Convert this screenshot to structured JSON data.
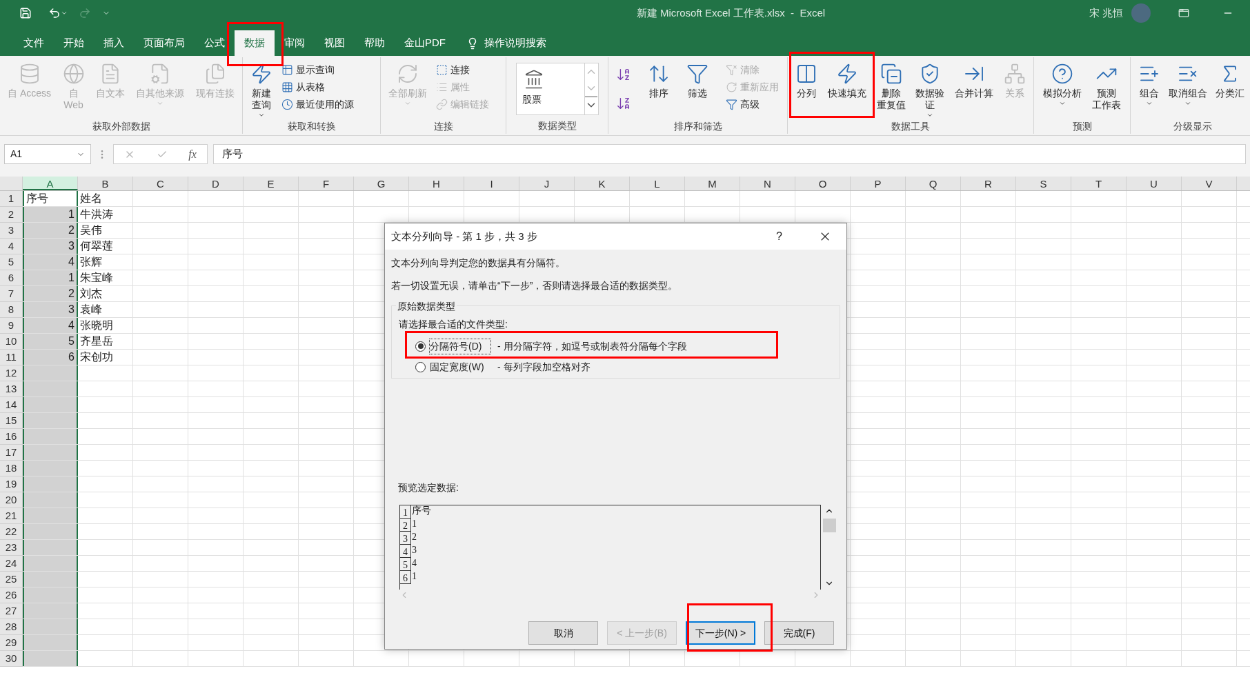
{
  "window": {
    "title": "新建 Microsoft Excel 工作表.xlsx  -  Excel",
    "user": "宋 兆恒"
  },
  "quick_access": {
    "redo_disabled": true
  },
  "menu_tabs": [
    {
      "label": "文件",
      "selected": false
    },
    {
      "label": "开始",
      "selected": false
    },
    {
      "label": "插入",
      "selected": false
    },
    {
      "label": "页面布局",
      "selected": false
    },
    {
      "label": "公式",
      "selected": false
    },
    {
      "label": "数据",
      "selected": true
    },
    {
      "label": "审阅",
      "selected": false
    },
    {
      "label": "视图",
      "selected": false
    },
    {
      "label": "帮助",
      "selected": false
    },
    {
      "label": "金山PDF",
      "selected": false
    }
  ],
  "tell_me": "操作说明搜索",
  "ribbon": {
    "groups": [
      {
        "label": "获取外部数据",
        "items": [
          {
            "kind": "large",
            "lines": [
              "自 Access"
            ],
            "disabled": true
          },
          {
            "kind": "large",
            "lines": [
              "自",
              "Web"
            ],
            "disabled": true
          },
          {
            "kind": "large",
            "lines": [
              "自文本"
            ],
            "disabled": true
          },
          {
            "kind": "large",
            "lines": [
              "自其他来源"
            ],
            "disabled": true,
            "dropdown": true
          },
          {
            "kind": "large",
            "lines": [
              "现有连接"
            ],
            "disabled": true
          }
        ]
      },
      {
        "label": "获取和转换",
        "items": [
          {
            "kind": "large",
            "lines": [
              "新建",
              "查询"
            ],
            "disabled": false,
            "dropdown": true
          },
          {
            "kind": "small",
            "lines": [
              "显示查询"
            ],
            "disabled": false
          },
          {
            "kind": "small",
            "lines": [
              "从表格"
            ],
            "disabled": false
          },
          {
            "kind": "small",
            "lines": [
              "最近使用的源"
            ],
            "disabled": false
          }
        ]
      },
      {
        "label": "连接",
        "items": [
          {
            "kind": "large",
            "lines": [
              "全部刷新"
            ],
            "disabled": true,
            "dropdown": true
          },
          {
            "kind": "small",
            "lines": [
              "连接"
            ],
            "disabled": false
          },
          {
            "kind": "small",
            "lines": [
              "属性"
            ],
            "disabled": true
          },
          {
            "kind": "small",
            "lines": [
              "编辑链接"
            ],
            "disabled": true
          }
        ]
      },
      {
        "label": "数据类型",
        "items": [
          {
            "kind": "gallery",
            "lines": [
              "股票"
            ],
            "disabled": false
          }
        ]
      },
      {
        "label": "排序和筛选",
        "items": [
          {
            "kind": "icon",
            "disabled": false
          },
          {
            "kind": "icon",
            "disabled": false
          },
          {
            "kind": "large",
            "lines": [
              "排序"
            ],
            "disabled": false
          },
          {
            "kind": "large",
            "lines": [
              "筛选"
            ],
            "disabled": false
          },
          {
            "kind": "small",
            "lines": [
              "清除"
            ],
            "disabled": true
          },
          {
            "kind": "small",
            "lines": [
              "重新应用"
            ],
            "disabled": true
          },
          {
            "kind": "small",
            "lines": [
              "高级"
            ],
            "disabled": false
          }
        ]
      },
      {
        "label": "数据工具",
        "items": [
          {
            "kind": "large",
            "lines": [
              "分列"
            ],
            "disabled": false
          },
          {
            "kind": "large",
            "lines": [
              "快速填充"
            ],
            "disabled": false
          },
          {
            "kind": "large",
            "lines": [
              "删除",
              "重复值"
            ],
            "disabled": false
          },
          {
            "kind": "large",
            "lines": [
              "数据验",
              "证"
            ],
            "disabled": false,
            "dropdown": true
          },
          {
            "kind": "large",
            "lines": [
              "合并计算"
            ],
            "disabled": false
          },
          {
            "kind": "large",
            "lines": [
              "关系"
            ],
            "disabled": true
          }
        ]
      },
      {
        "label": "预测",
        "items": [
          {
            "kind": "large",
            "lines": [
              "模拟分析"
            ],
            "disabled": false,
            "dropdown": true
          },
          {
            "kind": "large",
            "lines": [
              "预测",
              "工作表"
            ],
            "disabled": false
          }
        ]
      },
      {
        "label": "分级显示",
        "items": [
          {
            "kind": "large",
            "lines": [
              "组合"
            ],
            "disabled": false,
            "dropdown": true
          },
          {
            "kind": "large",
            "lines": [
              "取消组合"
            ],
            "disabled": false,
            "dropdown": true
          },
          {
            "kind": "large",
            "lines": [
              "分类汇"
            ],
            "disabled": false
          }
        ]
      }
    ]
  },
  "formula_bar": {
    "name_box": "A1",
    "function_label": "fx",
    "formula": "序号"
  },
  "sheet": {
    "columns": [
      {
        "label": "A",
        "selected": true
      },
      {
        "label": "B",
        "selected": false
      },
      {
        "label": "C",
        "selected": false
      },
      {
        "label": "D",
        "selected": false
      },
      {
        "label": "E",
        "selected": false
      },
      {
        "label": "F",
        "selected": false
      },
      {
        "label": "G",
        "selected": false
      },
      {
        "label": "H",
        "selected": false
      },
      {
        "label": "I",
        "selected": false
      },
      {
        "label": "J",
        "selected": false
      },
      {
        "label": "K",
        "selected": false
      },
      {
        "label": "L",
        "selected": false
      },
      {
        "label": "M",
        "selected": false
      },
      {
        "label": "N",
        "selected": false
      },
      {
        "label": "O",
        "selected": false
      },
      {
        "label": "P",
        "selected": false
      },
      {
        "label": "Q",
        "selected": false
      },
      {
        "label": "R",
        "selected": false
      },
      {
        "label": "S",
        "selected": false
      },
      {
        "label": "T",
        "selected": false
      },
      {
        "label": "U",
        "selected": false
      },
      {
        "label": "V",
        "selected": false
      }
    ],
    "rows": [
      {
        "label": "1",
        "cells": [
          {
            "text": "序号",
            "kind": "text",
            "active": true
          },
          {
            "text": "姓名",
            "kind": "text"
          }
        ]
      },
      {
        "label": "2",
        "cells": [
          {
            "text": "1",
            "kind": "number"
          },
          {
            "text": "牛洪涛",
            "kind": "text"
          }
        ]
      },
      {
        "label": "3",
        "cells": [
          {
            "text": "2",
            "kind": "number"
          },
          {
            "text": "吴伟",
            "kind": "text"
          }
        ]
      },
      {
        "label": "4",
        "cells": [
          {
            "text": "3",
            "kind": "number"
          },
          {
            "text": "何翠莲",
            "kind": "text"
          }
        ]
      },
      {
        "label": "5",
        "cells": [
          {
            "text": "4",
            "kind": "number"
          },
          {
            "text": "张辉",
            "kind": "text"
          }
        ]
      },
      {
        "label": "6",
        "cells": [
          {
            "text": "1",
            "kind": "number"
          },
          {
            "text": "朱宝峰",
            "kind": "text"
          }
        ]
      },
      {
        "label": "7",
        "cells": [
          {
            "text": "2",
            "kind": "number"
          },
          {
            "text": "刘杰",
            "kind": "text"
          }
        ]
      },
      {
        "label": "8",
        "cells": [
          {
            "text": "3",
            "kind": "number"
          },
          {
            "text": "袁峰",
            "kind": "text"
          }
        ]
      },
      {
        "label": "9",
        "cells": [
          {
            "text": "4",
            "kind": "number"
          },
          {
            "text": "张晓明",
            "kind": "text"
          }
        ]
      },
      {
        "label": "10",
        "cells": [
          {
            "text": "5",
            "kind": "number"
          },
          {
            "text": "齐星岳",
            "kind": "text"
          }
        ]
      },
      {
        "label": "11",
        "cells": [
          {
            "text": "6",
            "kind": "number"
          },
          {
            "text": "宋创功",
            "kind": "text"
          }
        ]
      },
      {
        "label": "12"
      },
      {
        "label": "13"
      },
      {
        "label": "14"
      },
      {
        "label": "15"
      },
      {
        "label": "16"
      },
      {
        "label": "17"
      },
      {
        "label": "18"
      },
      {
        "label": "19"
      },
      {
        "label": "20"
      },
      {
        "label": "21"
      },
      {
        "label": "22"
      },
      {
        "label": "23"
      },
      {
        "label": "24"
      },
      {
        "label": "25"
      },
      {
        "label": "26"
      },
      {
        "label": "27"
      },
      {
        "label": "28"
      },
      {
        "label": "29"
      },
      {
        "label": "30"
      }
    ]
  },
  "dialog": {
    "title": "文本分列向导 - 第 1 步，共 3 步",
    "help": "?",
    "intro": "文本分列向导判定您的数据具有分隔符。",
    "instruction": "若一切设置无误，请单击“下一步”，否则请选择最合适的数据类型。",
    "group_title": "原始数据类型",
    "prompt": "请选择最合适的文件类型:",
    "options": [
      {
        "label": "分隔符号(D)",
        "description": "- 用分隔字符，如逗号或制表符分隔每个字段",
        "selected": true
      },
      {
        "label": "固定宽度(W)",
        "description": "- 每列字段加空格对齐",
        "selected": false
      }
    ],
    "preview_label": "预览选定数据:",
    "preview_rows": [
      {
        "number": "1",
        "text": "序号"
      },
      {
        "number": "2",
        "text": "1"
      },
      {
        "number": "3",
        "text": "2"
      },
      {
        "number": "4",
        "text": "3"
      },
      {
        "number": "5",
        "text": "4"
      },
      {
        "number": "6",
        "text": "1"
      }
    ],
    "buttons": [
      {
        "label": "取消",
        "disabled": false,
        "default": false
      },
      {
        "label": "< 上一步(B)",
        "disabled": true,
        "default": false
      },
      {
        "label": "下一步(N) >",
        "disabled": false,
        "default": true
      },
      {
        "label": "完成(F)",
        "disabled": false,
        "default": false
      }
    ]
  }
}
